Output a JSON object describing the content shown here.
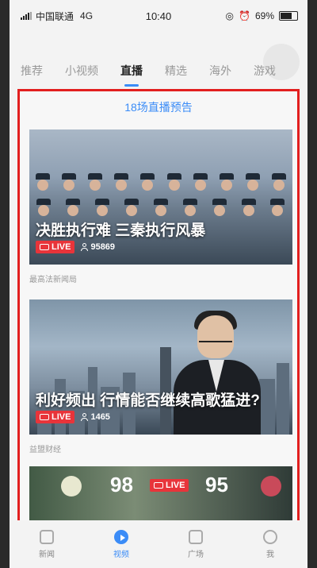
{
  "status_bar": {
    "carrier": "中国联通",
    "network": "4G",
    "time": "10:40",
    "battery": "69%"
  },
  "tabs": [
    "推荐",
    "小视频",
    "直播",
    "精选",
    "海外",
    "游戏"
  ],
  "active_tab": "直播",
  "preview_header": "18场直播预告",
  "cards": [
    {
      "title": "决胜执行难 三秦执行风暴",
      "live_label": "LIVE",
      "viewers": "95869",
      "source": "最高法新闻局"
    },
    {
      "title": "利好频出 行情能否继续高歌猛进?",
      "live_label": "LIVE",
      "viewers": "1465",
      "source": "益盟财经"
    },
    {
      "live_label": "LIVE",
      "score_left": "98",
      "score_right": "95"
    }
  ],
  "bottom_nav": [
    {
      "label": "新闻",
      "icon": "news-icon"
    },
    {
      "label": "视频",
      "icon": "video-play-icon"
    },
    {
      "label": "广场",
      "icon": "bookmark-icon"
    },
    {
      "label": "我",
      "icon": "profile-icon"
    }
  ],
  "colors": {
    "accent": "#3b8cf7",
    "live": "#e8343a",
    "frame": "#e21f1f"
  }
}
